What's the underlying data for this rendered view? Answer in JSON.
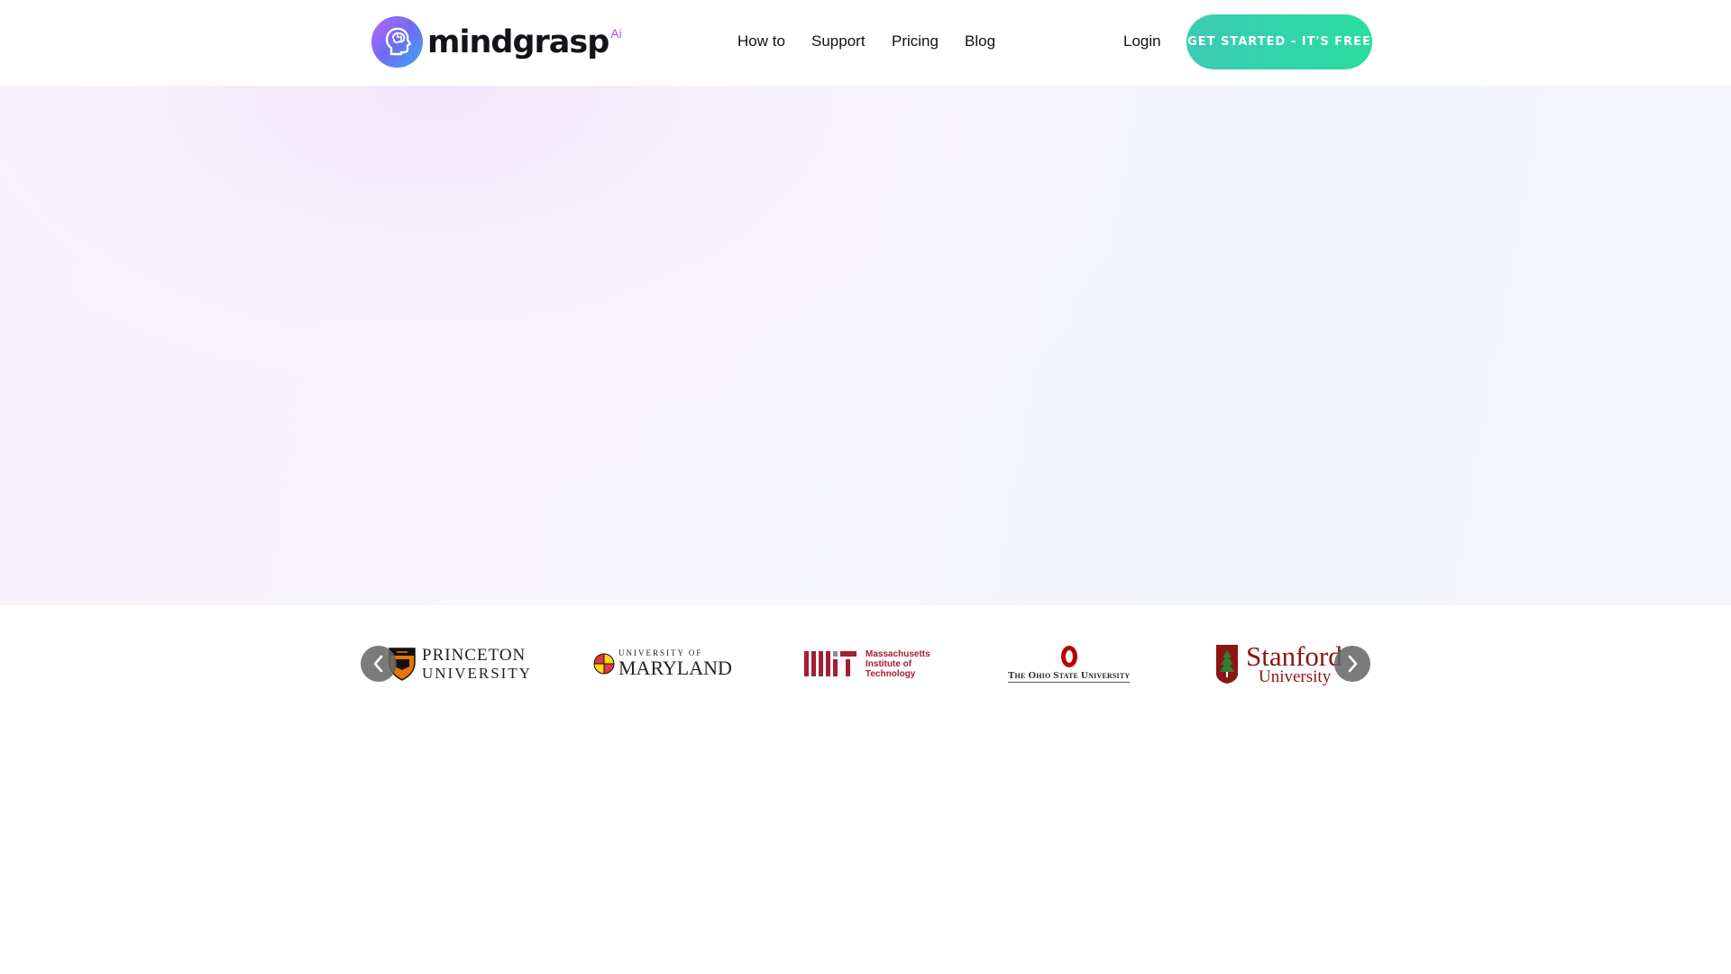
{
  "header": {
    "logo": {
      "wordmark": "mindgrasp",
      "superscript": "Ai"
    },
    "nav": [
      {
        "label": "How to",
        "name": "nav-how-to"
      },
      {
        "label": "Support",
        "name": "nav-support"
      },
      {
        "label": "Pricing",
        "name": "nav-pricing"
      },
      {
        "label": "Blog",
        "name": "nav-blog"
      }
    ],
    "login_label": "Login",
    "cta_label": "GET STARTED - IT'S FREE"
  },
  "carousel": {
    "logos": [
      {
        "name": "princeton-logo",
        "line1": "PRINCETON",
        "line2": "UNIVERSITY"
      },
      {
        "name": "maryland-logo",
        "line1": "UNIVERSITY OF",
        "line2": "MARYLAND"
      },
      {
        "name": "mit-logo",
        "lines": [
          "Massachusetts",
          "Institute of",
          "Technology"
        ]
      },
      {
        "name": "ohio-state-logo",
        "line1": "The Ohio State University"
      },
      {
        "name": "stanford-logo",
        "line1": "Stanford",
        "line2": "University"
      }
    ]
  },
  "colors": {
    "cta_gradient_start": "#3ccbb5",
    "cta_gradient_end": "#29dd9f",
    "logo_accent": "#b04fe0",
    "mit_red": "#a31f34",
    "stanford_red": "#8c1515",
    "osu_red": "#bb0000"
  },
  "icons": {
    "prev": "chevron-left-icon",
    "next": "chevron-right-icon",
    "logo": "head-brain-icon"
  }
}
